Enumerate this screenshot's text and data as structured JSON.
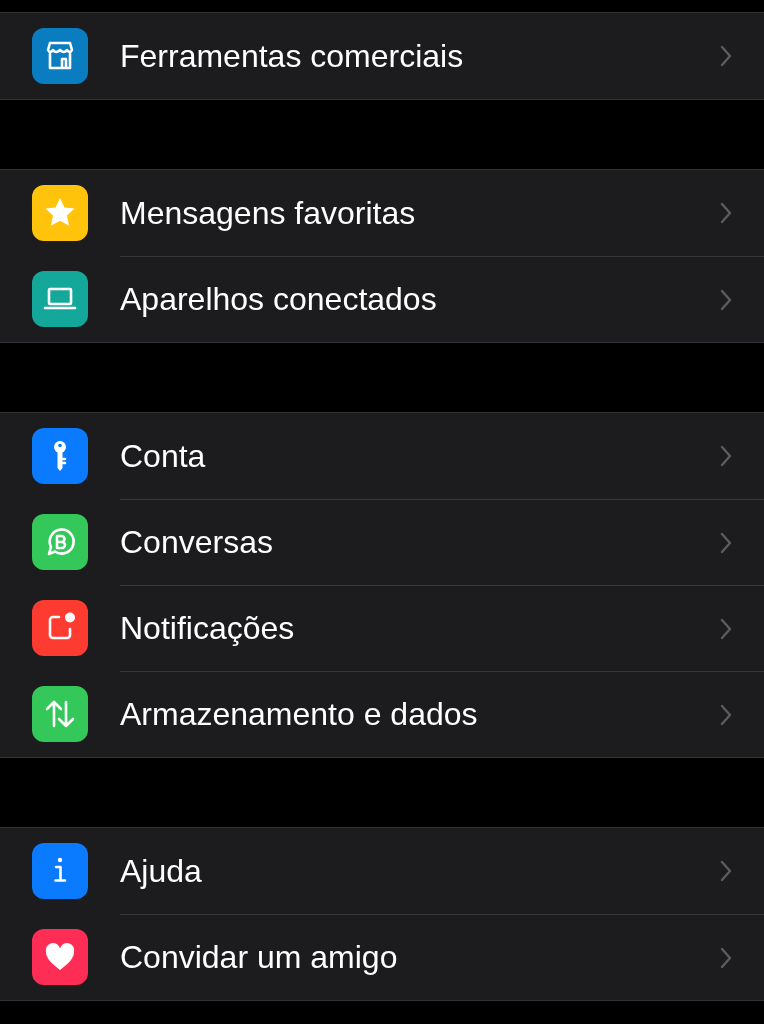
{
  "groups": [
    {
      "items": [
        {
          "label": "Ferramentas comerciais",
          "kind": "store",
          "color": "#0a7cc0"
        }
      ]
    },
    {
      "items": [
        {
          "label": "Mensagens favoritas",
          "kind": "star",
          "color": "#fec30a"
        },
        {
          "label": "Aparelhos conectados",
          "kind": "laptop",
          "color": "#14a89a"
        }
      ]
    },
    {
      "items": [
        {
          "label": "Conta",
          "kind": "key",
          "color": "#0a7afe"
        },
        {
          "label": "Conversas",
          "kind": "chat",
          "color": "#34c759"
        },
        {
          "label": "Notificações",
          "kind": "notification",
          "color": "#fe3b30"
        },
        {
          "label": "Armazenamento e dados",
          "kind": "arrows",
          "color": "#34c759"
        }
      ]
    },
    {
      "items": [
        {
          "label": "Ajuda",
          "kind": "info",
          "color": "#0a7afe"
        },
        {
          "label": "Convidar um amigo",
          "kind": "heart",
          "color": "#fe2d55"
        }
      ]
    }
  ]
}
